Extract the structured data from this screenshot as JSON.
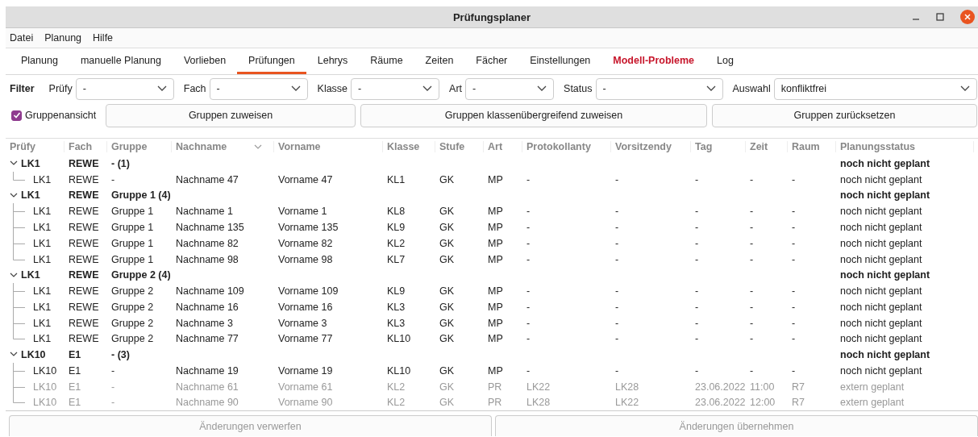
{
  "window": {
    "title": "Prüfungsplaner"
  },
  "menu": [
    "Datei",
    "Planung",
    "Hilfe"
  ],
  "tabs": [
    {
      "label": "Planung",
      "selected": false,
      "alert": false
    },
    {
      "label": "manuelle Planung",
      "selected": false,
      "alert": false
    },
    {
      "label": "Vorlieben",
      "selected": false,
      "alert": false
    },
    {
      "label": "Prüfungen",
      "selected": true,
      "alert": false
    },
    {
      "label": "Lehrys",
      "selected": false,
      "alert": false
    },
    {
      "label": "Räume",
      "selected": false,
      "alert": false
    },
    {
      "label": "Zeiten",
      "selected": false,
      "alert": false
    },
    {
      "label": "Fächer",
      "selected": false,
      "alert": false
    },
    {
      "label": "Einstellungen",
      "selected": false,
      "alert": false
    },
    {
      "label": "Modell-Probleme",
      "selected": false,
      "alert": true
    },
    {
      "label": "Log",
      "selected": false,
      "alert": false
    }
  ],
  "filter": {
    "label": "Filter",
    "fields": [
      {
        "label": "Prüfy",
        "value": "-"
      },
      {
        "label": "Fach",
        "value": "-"
      },
      {
        "label": "Klasse",
        "value": "-"
      },
      {
        "label": "Art",
        "value": "-"
      },
      {
        "label": "Status",
        "value": "-"
      },
      {
        "label": "Auswahl",
        "value": "konfliktfrei"
      }
    ]
  },
  "group_view": {
    "label": "Gruppenansicht",
    "checked": true
  },
  "group_buttons": [
    "Gruppen zuweisen",
    "Gruppen klassenübergreifend zuweisen",
    "Gruppen zurücksetzen"
  ],
  "table": {
    "columns": [
      {
        "label": "Prüfy",
        "sorted": false
      },
      {
        "label": "Fach",
        "sorted": false
      },
      {
        "label": "Gruppe",
        "sorted": false
      },
      {
        "label": "Nachname",
        "sorted": true
      },
      {
        "label": "Vorname",
        "sorted": false
      },
      {
        "label": "Klasse",
        "sorted": false
      },
      {
        "label": "Stufe",
        "sorted": false
      },
      {
        "label": "Art",
        "sorted": false
      },
      {
        "label": "Protokollanty",
        "sorted": false
      },
      {
        "label": "Vorsitzendy",
        "sorted": false
      },
      {
        "label": "Tag",
        "sorted": false
      },
      {
        "label": "Zeit",
        "sorted": false
      },
      {
        "label": "Raum",
        "sorted": false
      },
      {
        "label": "Planungsstatus",
        "sorted": false
      }
    ],
    "groups": [
      {
        "cells": [
          "LK1",
          "REWE",
          "- (1)"
        ],
        "status": "noch nicht geplant",
        "expanded": true,
        "children": [
          {
            "cells": [
              "LK1",
              "REWE",
              "-",
              "Nachname 47",
              "Vorname 47",
              "KL1",
              "GK",
              "MP",
              "-",
              "-",
              "-",
              "-",
              "-",
              "noch nicht geplant"
            ],
            "disabled": false
          }
        ]
      },
      {
        "cells": [
          "LK1",
          "REWE",
          "Gruppe 1 (4)"
        ],
        "status": "noch nicht geplant",
        "expanded": true,
        "children": [
          {
            "cells": [
              "LK1",
              "REWE",
              "Gruppe 1",
              "Nachname 1",
              "Vorname 1",
              "KL8",
              "GK",
              "MP",
              "-",
              "-",
              "-",
              "-",
              "-",
              "noch nicht geplant"
            ],
            "disabled": false
          },
          {
            "cells": [
              "LK1",
              "REWE",
              "Gruppe 1",
              "Nachname 135",
              "Vorname 135",
              "KL9",
              "GK",
              "MP",
              "-",
              "-",
              "-",
              "-",
              "-",
              "noch nicht geplant"
            ],
            "disabled": false
          },
          {
            "cells": [
              "LK1",
              "REWE",
              "Gruppe 1",
              "Nachname 82",
              "Vorname 82",
              "KL2",
              "GK",
              "MP",
              "-",
              "-",
              "-",
              "-",
              "-",
              "noch nicht geplant"
            ],
            "disabled": false
          },
          {
            "cells": [
              "LK1",
              "REWE",
              "Gruppe 1",
              "Nachname 98",
              "Vorname 98",
              "KL7",
              "GK",
              "MP",
              "-",
              "-",
              "-",
              "-",
              "-",
              "noch nicht geplant"
            ],
            "disabled": false
          }
        ]
      },
      {
        "cells": [
          "LK1",
          "REWE",
          "Gruppe 2 (4)"
        ],
        "status": "noch nicht geplant",
        "expanded": true,
        "children": [
          {
            "cells": [
              "LK1",
              "REWE",
              "Gruppe 2",
              "Nachname 109",
              "Vorname 109",
              "KL9",
              "GK",
              "MP",
              "-",
              "-",
              "-",
              "-",
              "-",
              "noch nicht geplant"
            ],
            "disabled": false
          },
          {
            "cells": [
              "LK1",
              "REWE",
              "Gruppe 2",
              "Nachname 16",
              "Vorname 16",
              "KL3",
              "GK",
              "MP",
              "-",
              "-",
              "-",
              "-",
              "-",
              "noch nicht geplant"
            ],
            "disabled": false
          },
          {
            "cells": [
              "LK1",
              "REWE",
              "Gruppe 2",
              "Nachname 3",
              "Vorname 3",
              "KL3",
              "GK",
              "MP",
              "-",
              "-",
              "-",
              "-",
              "-",
              "noch nicht geplant"
            ],
            "disabled": false
          },
          {
            "cells": [
              "LK1",
              "REWE",
              "Gruppe 2",
              "Nachname 77",
              "Vorname 77",
              "KL10",
              "GK",
              "MP",
              "-",
              "-",
              "-",
              "-",
              "-",
              "noch nicht geplant"
            ],
            "disabled": false
          }
        ]
      },
      {
        "cells": [
          "LK10",
          "E1",
          "- (3)"
        ],
        "status": "noch nicht geplant",
        "expanded": true,
        "children": [
          {
            "cells": [
              "LK10",
              "E1",
              "-",
              "Nachname 19",
              "Vorname 19",
              "KL10",
              "GK",
              "MP",
              "-",
              "-",
              "-",
              "-",
              "-",
              "noch nicht geplant"
            ],
            "disabled": false
          },
          {
            "cells": [
              "LK10",
              "E1",
              "-",
              "Nachname 61",
              "Vorname 61",
              "KL2",
              "GK",
              "PR",
              "LK22",
              "LK28",
              "23.06.2022",
              "11:00",
              "R7",
              "extern geplant"
            ],
            "disabled": true
          },
          {
            "cells": [
              "LK10",
              "E1",
              "-",
              "Nachname 90",
              "Vorname 90",
              "KL2",
              "GK",
              "PR",
              "LK28",
              "LK22",
              "23.06.2022",
              "12:00",
              "R7",
              "extern geplant"
            ],
            "disabled": true
          }
        ]
      }
    ]
  },
  "actions": [
    "Änderungen verwerfen",
    "Änderungen übernehmen"
  ]
}
